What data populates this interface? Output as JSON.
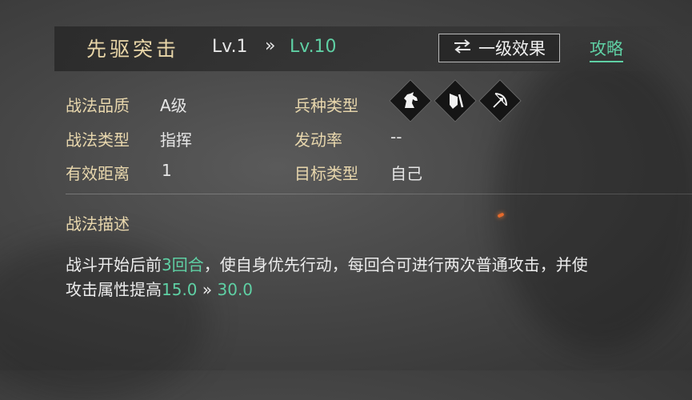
{
  "header": {
    "skill_name": "先驱突击",
    "level_from": "Lv.1",
    "level_arrow": "»",
    "level_to": "Lv.10",
    "effect_button_icon": "swap-arrows-icon",
    "effect_button_label": "一级效果",
    "guide_link": "攻略"
  },
  "attributes": {
    "quality_label": "战法品质",
    "quality_value": "A级",
    "type_label": "战法类型",
    "type_value": "指挥",
    "range_label": "有效距离",
    "range_value": "1",
    "troop_label": "兵种类型",
    "troop_icons": [
      "cavalry-horse-icon",
      "shield-infantry-icon",
      "bow-archer-icon"
    ],
    "rate_label": "发动率",
    "rate_value": "--",
    "target_label": "目标类型",
    "target_value": "自己"
  },
  "description": {
    "title": "战法描述",
    "line1_a": "战斗开始后前",
    "line1_highlight": "3回合",
    "line1_b": "，使自身优先行动，每回合可进行两次普通攻击，并使",
    "line2_a": "攻击属性提高",
    "line2_from": "15.0",
    "line2_arrow": "»",
    "line2_to": "30.0"
  },
  "colors": {
    "accent_green": "#5fd0a4",
    "label_gold": "#e8d7ad"
  }
}
